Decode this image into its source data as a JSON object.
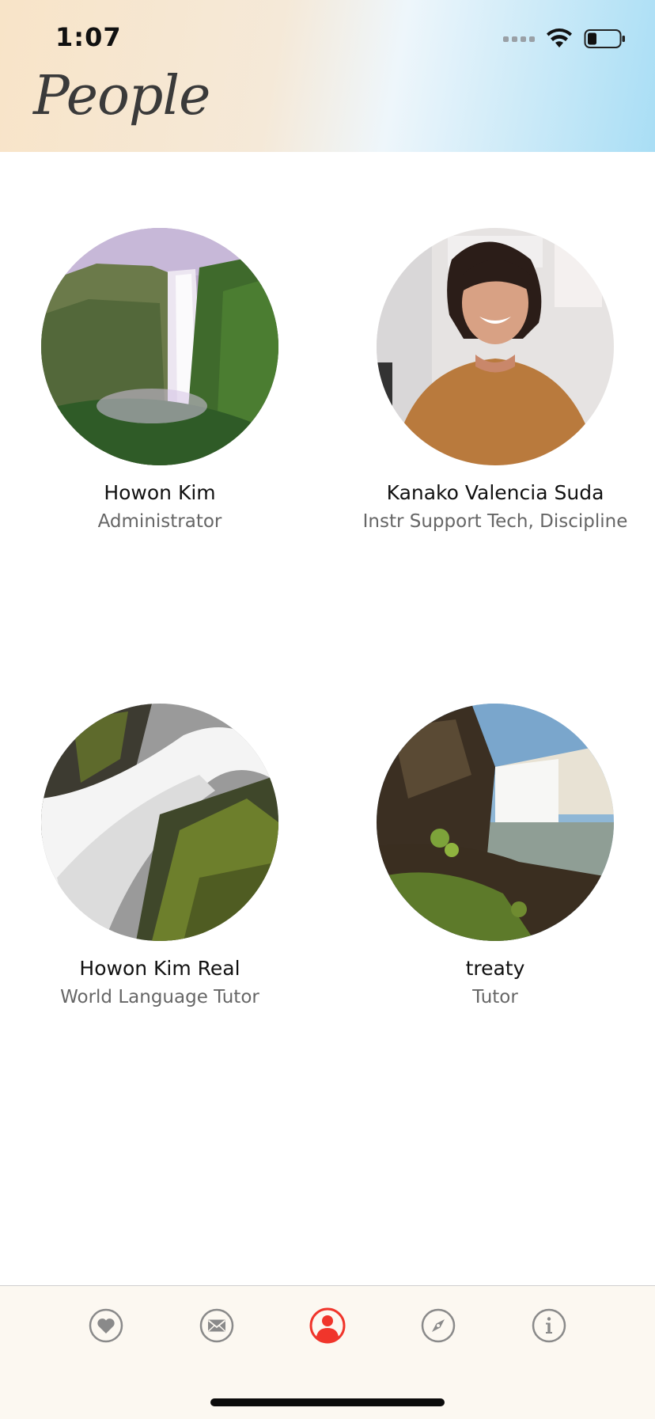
{
  "status_bar": {
    "time": "1:07",
    "icons": [
      "cellular-signal-icon",
      "wifi-icon",
      "battery-icon"
    ]
  },
  "header": {
    "title": "People"
  },
  "people": [
    {
      "name": "Howon Kim",
      "role": "Administrator",
      "avatar": "waterfall-photo"
    },
    {
      "name": "Kanako Valencia Suda",
      "role": "Instr Support Tech, Discipline",
      "avatar": "portrait-photo"
    },
    {
      "name": "Howon Kim Real",
      "role": "World Language Tutor",
      "avatar": "waterfall-rocks-photo"
    },
    {
      "name": "treaty",
      "role": "Tutor",
      "avatar": "waterfall-meadow-photo"
    }
  ],
  "tab_bar": {
    "tabs": [
      {
        "icon": "heart-icon",
        "active": false
      },
      {
        "icon": "mail-icon",
        "active": false
      },
      {
        "icon": "person-icon",
        "active": true
      },
      {
        "icon": "compass-icon",
        "active": false
      },
      {
        "icon": "info-icon",
        "active": false
      }
    ],
    "active_color": "#f0352b",
    "inactive_color": "#8a8a8a"
  }
}
